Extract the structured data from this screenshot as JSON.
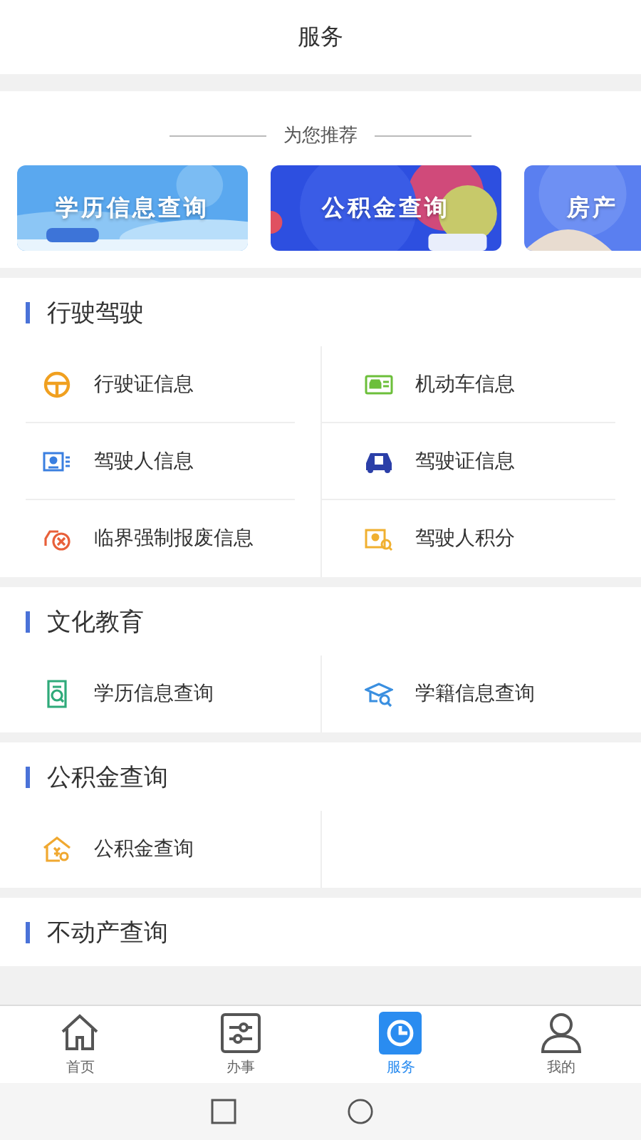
{
  "header": {
    "title": "服务"
  },
  "recommend": {
    "title": "为您推荐",
    "banners": [
      {
        "label": "学历信息查询"
      },
      {
        "label": "公积金查询"
      },
      {
        "label": "房产"
      }
    ]
  },
  "sections": [
    {
      "title": "行驶驾驶",
      "items": [
        {
          "label": "行驶证信息"
        },
        {
          "label": "机动车信息"
        },
        {
          "label": "驾驶人信息"
        },
        {
          "label": "驾驶证信息"
        },
        {
          "label": "临界强制报废信息"
        },
        {
          "label": "驾驶人积分"
        }
      ]
    },
    {
      "title": "文化教育",
      "items": [
        {
          "label": "学历信息查询"
        },
        {
          "label": "学籍信息查询"
        }
      ]
    },
    {
      "title": "公积金查询",
      "items": [
        {
          "label": "公积金查询"
        }
      ]
    },
    {
      "title": "不动产查询"
    }
  ],
  "tabs": [
    {
      "label": "首页",
      "selected": false
    },
    {
      "label": "办事",
      "selected": false
    },
    {
      "label": "服务",
      "selected": true
    },
    {
      "label": "我的",
      "selected": false
    }
  ]
}
